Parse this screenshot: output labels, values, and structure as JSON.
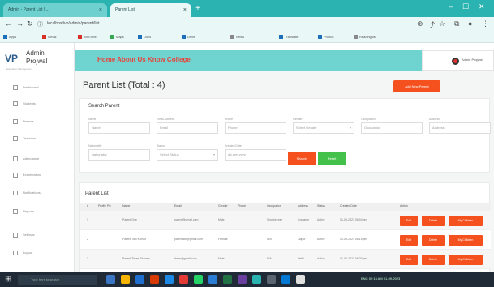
{
  "browser": {
    "tabs": [
      {
        "label": "Admin - Parent List | ...",
        "active": false
      },
      {
        "label": "Parent List",
        "active": true
      }
    ],
    "url": "localhost/vp/admin/parent/list",
    "bookmarks": [
      "Apps",
      "Gmail",
      "YouTube",
      "Maps",
      "Docs",
      "Drive",
      "News",
      "Translate",
      "Photos",
      "Reading list"
    ]
  },
  "sidebar": {
    "brand_mark": "VP",
    "brand_line1": "Admin",
    "brand_line2": "Projwal",
    "brand_tagline": "Education Management",
    "items": [
      {
        "label": "Dashboard"
      },
      {
        "label": "Students"
      },
      {
        "label": "Parents"
      },
      {
        "label": "Teachers"
      },
      {
        "label": "Attendance"
      },
      {
        "label": "Examination"
      },
      {
        "label": "Notifications"
      },
      {
        "label": "Reports"
      },
      {
        "label": "Settings"
      },
      {
        "label": "Logout"
      }
    ]
  },
  "header": {
    "title": "Home  About Us  Know College",
    "user_name": "Admin Projwal"
  },
  "main": {
    "page_title": "Parent List (Total : 4)",
    "add_button": "Add New Parent",
    "search_panel": {
      "title": "Search Parent",
      "fields": [
        {
          "label": "Name",
          "placeholder": "Name",
          "select": false
        },
        {
          "label": "Email Address",
          "placeholder": "Email",
          "select": false
        },
        {
          "label": "Phone",
          "placeholder": "Phone",
          "select": false
        },
        {
          "label": "Gender",
          "placeholder": "Select Gender",
          "select": true
        },
        {
          "label": "Occupation",
          "placeholder": "Occupation",
          "select": false
        },
        {
          "label": "Address",
          "placeholder": "Address",
          "select": false
        },
        {
          "label": "Nationality",
          "placeholder": "Nationality",
          "select": false
        },
        {
          "label": "Status",
          "placeholder": "Select Status",
          "select": true
        },
        {
          "label": "Created Date",
          "placeholder": "dd-mm-yyyy",
          "select": false
        }
      ],
      "search_button": "Search",
      "reset_button": "Reset"
    },
    "list_panel": {
      "title": "Parent List",
      "columns": [
        "#",
        "Profile Pic",
        "Name",
        "Email",
        "Gender",
        "Phone",
        "Occupation",
        "Address",
        "Status",
        "Created Date",
        "Action"
      ],
      "rows": [
        {
          "num": "1",
          "name": "Parent One",
          "email": "parent@gmail.com",
          "phone": "Male",
          "occ": "Shopkeeper",
          "addr": "Comanie",
          "status": "Active",
          "date": "01-09-2023 06:04 pm"
        },
        {
          "num": "2",
          "name": "Parent Two Kumar",
          "email": "parenttwo@gmail.com",
          "phone": "Female",
          "occ": "N/A",
          "addr": "Jaipur",
          "status": "Active",
          "date": "01-09-2023 06:15 pm"
        },
        {
          "num": "3",
          "name": "Parent Three Sharma",
          "email": "three@gmail.com",
          "phone": "Male",
          "occ": "N/A",
          "addr": "Delhi",
          "status": "Active",
          "date": "01-09-2023 06:20 pm"
        }
      ],
      "row_actions": {
        "edit": "Edit",
        "delete": "Delete",
        "my_children": "My Children"
      }
    }
  },
  "taskbar": {
    "search_placeholder": "Type here to search",
    "status_text": "ENG 09:15 AM 01-09-2023"
  },
  "colors": {
    "accent": "#f4511e",
    "header_bg": "#6fd4cf",
    "success": "#43c14a",
    "tab_bar": "#2bb3b1"
  }
}
